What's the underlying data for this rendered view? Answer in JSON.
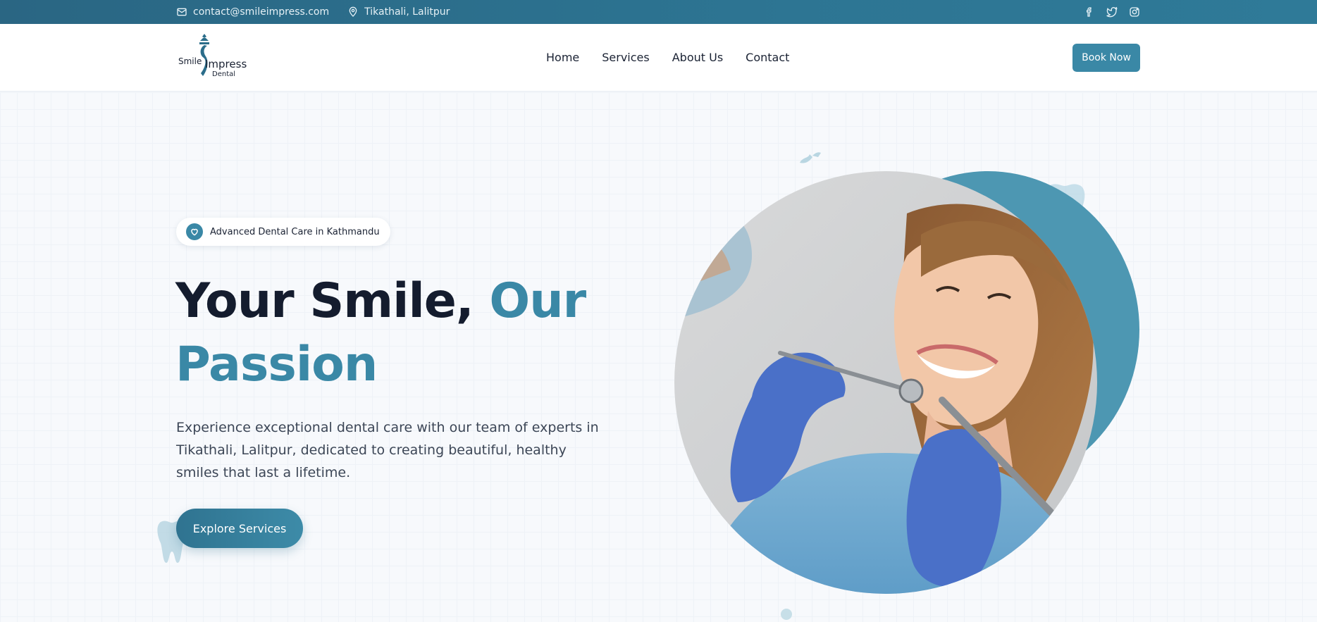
{
  "topbar": {
    "email": "contact@smileimpress.com",
    "location": "Tikathali, Lalitpur",
    "email_icon": "mail-icon",
    "location_icon": "map-pin-icon",
    "social": [
      "facebook-icon",
      "twitter-icon",
      "instagram-icon"
    ]
  },
  "header": {
    "logo": {
      "word1": "Smile",
      "word2": "Impress",
      "word3": "Dental"
    },
    "nav": [
      "Home",
      "Services",
      "About Us",
      "Contact"
    ],
    "cta": "Book Now"
  },
  "hero": {
    "badge": "Advanced Dental Care in Kathmandu",
    "badge_icon": "heart-icon",
    "title_part1": "Your Smile, ",
    "title_accent": "Our Passion",
    "lead": "Experience exceptional dental care with our team of experts in Tikathali, Lalitpur, dedicated to creating beautiful, healthy smiles that last a lifetime.",
    "button": "Explore Services"
  },
  "colors": {
    "primary": "#3a88a6",
    "topbar": "#2b6d8a",
    "heading": "#141c2e",
    "accent_blob": "#4d97b2"
  }
}
